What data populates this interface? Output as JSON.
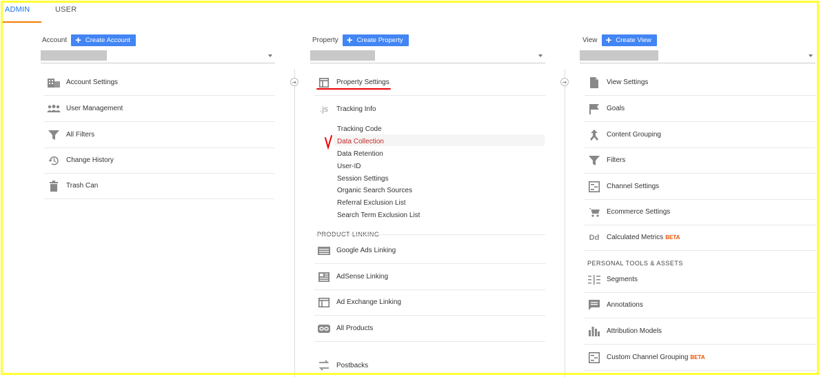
{
  "tabs": {
    "admin": "ADMIN",
    "user": "USER"
  },
  "account": {
    "label": "Account",
    "create": "Create Account",
    "items": [
      {
        "label": "Account Settings",
        "icon": "building-icon"
      },
      {
        "label": "User Management",
        "icon": "people-icon"
      },
      {
        "label": "All Filters",
        "icon": "filter-icon"
      },
      {
        "label": "Change History",
        "icon": "history-icon"
      },
      {
        "label": "Trash Can",
        "icon": "trash-icon"
      }
    ]
  },
  "property": {
    "label": "Property",
    "create": "Create Property",
    "items": [
      {
        "label": "Property Settings",
        "icon": "layout-icon"
      },
      {
        "label": "Tracking Info",
        "icon": "js-icon",
        "icon_text": ".js"
      }
    ],
    "tracking_sub": [
      "Tracking Code",
      "Data Collection",
      "Data Retention",
      "User-ID",
      "Session Settings",
      "Organic Search Sources",
      "Referral Exclusion List",
      "Search Term Exclusion List"
    ],
    "product_linking_title": "PRODUCT LINKING",
    "linking": [
      {
        "label": "Google Ads Linking",
        "icon": "ads-icon"
      },
      {
        "label": "AdSense Linking",
        "icon": "adsense-icon"
      },
      {
        "label": "Ad Exchange Linking",
        "icon": "adx-icon"
      },
      {
        "label": "All Products",
        "icon": "link-icon"
      },
      {
        "label": "Postbacks",
        "icon": "postbacks-icon"
      }
    ]
  },
  "view": {
    "label": "View",
    "create": "Create View",
    "items": [
      {
        "label": "View Settings",
        "icon": "document-icon"
      },
      {
        "label": "Goals",
        "icon": "flag-icon"
      },
      {
        "label": "Content Grouping",
        "icon": "grouping-icon"
      },
      {
        "label": "Filters",
        "icon": "filter-icon"
      },
      {
        "label": "Channel Settings",
        "icon": "channel-icon"
      },
      {
        "label": "Ecommerce Settings",
        "icon": "cart-icon"
      },
      {
        "label": "Calculated Metrics",
        "icon": "dd-icon",
        "icon_text": "Dd",
        "badge": "BETA"
      }
    ],
    "personal_title": "PERSONAL TOOLS & ASSETS",
    "personal": [
      {
        "label": "Segments",
        "icon": "segments-icon"
      },
      {
        "label": "Annotations",
        "icon": "annotation-icon"
      },
      {
        "label": "Attribution Models",
        "icon": "bar-chart-icon"
      },
      {
        "label": "Custom Channel Grouping",
        "icon": "channel-icon",
        "badge": "BETA"
      }
    ]
  },
  "colors": {
    "accent": "#4285f4",
    "tab_active": "#1a73e8",
    "tab_underline": "#f57c00",
    "highlight_annotation": "#ee0000",
    "frame": "#ffff33"
  }
}
